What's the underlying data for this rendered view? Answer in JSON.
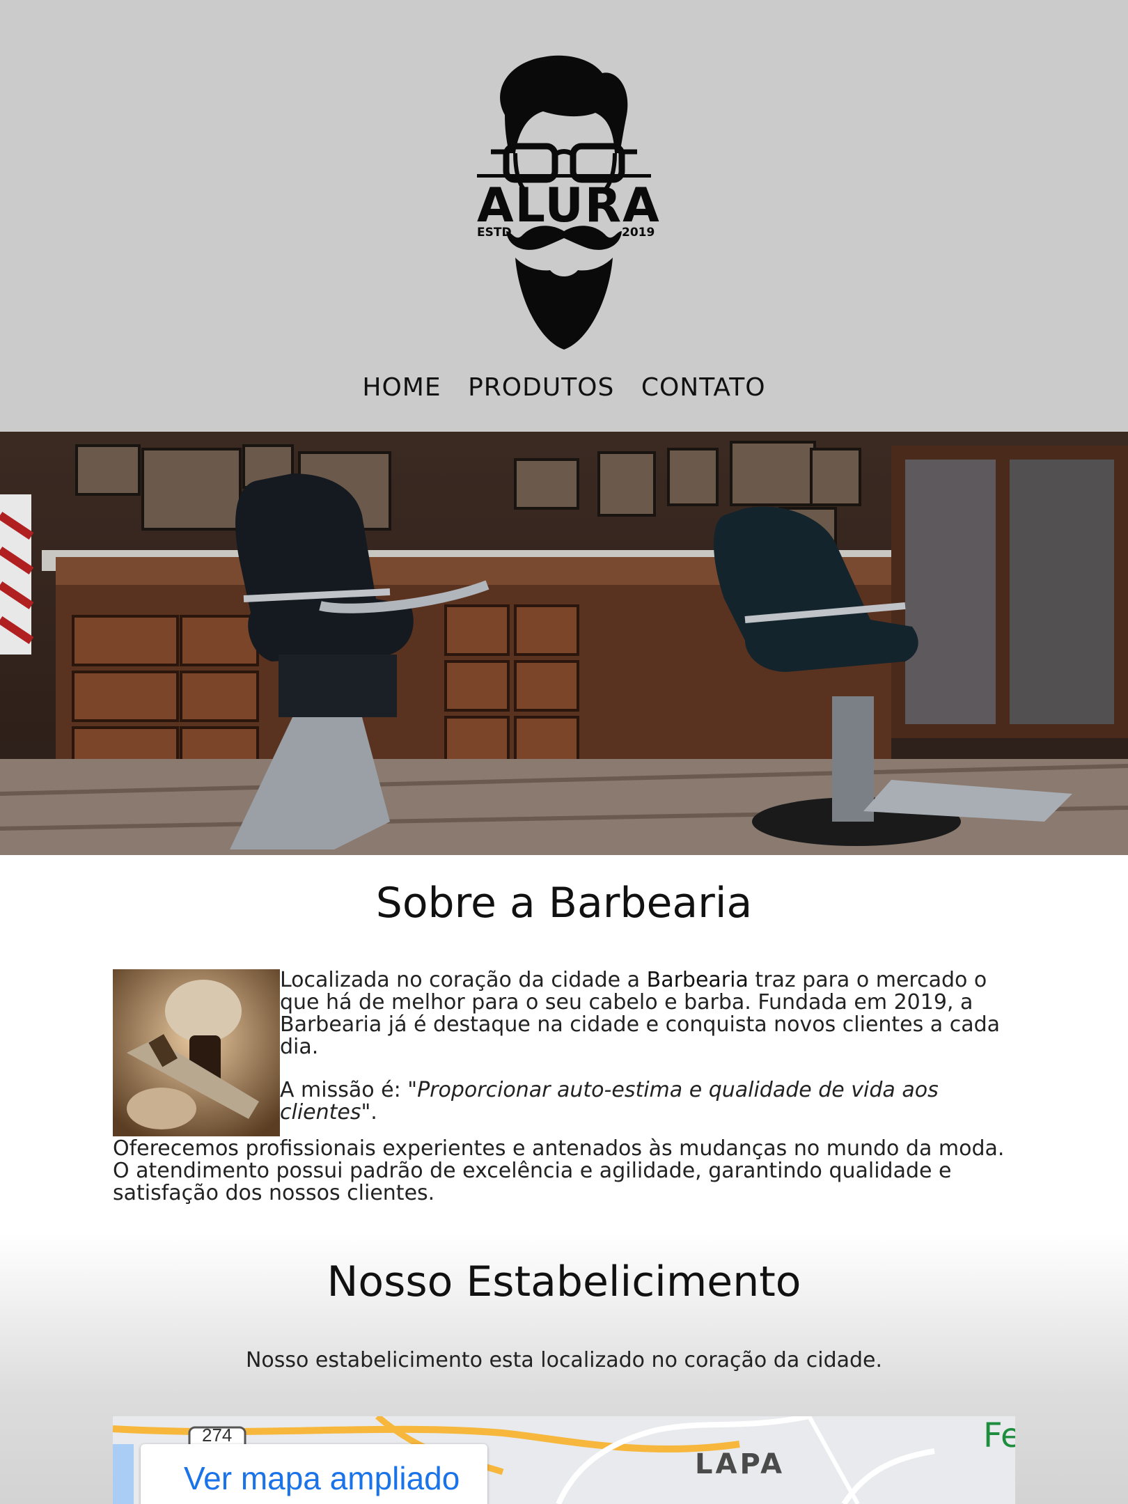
{
  "header": {
    "logo": {
      "brand": "ALURA",
      "estd": "ESTD",
      "year": "2019"
    },
    "nav": [
      "HOME",
      "PRODUTOS",
      "CONTATO"
    ],
    "background_color": "#cbcbcb"
  },
  "hero": {
    "subject": "barbershop interior with two barber chairs"
  },
  "about": {
    "title": "Sobre a Barbearia",
    "p1_before": "Localizada no coração da cidade a ",
    "p1_bold": "Barbearia",
    "p1_after": " traz para o mercado o que há de melhor para o seu cabelo e barba. Fundada em 2019, a Barbearia já é destaque na cidade e conquista novos clientes a cada dia.",
    "mission_prefix": "A missão é: ",
    "mission_quote": "\"Proporcionar auto-estima e qualidade de vida aos clientes\"",
    "mission_suffix": ".",
    "p3": "Oferecemos profissionais experientes e antenados às mudanças no mundo da moda. O atendimento possui padrão de excelência e agilidade, garantindo qualidade e satisfação dos nossos clientes."
  },
  "establishment": {
    "title": "Nosso Estabelicimento",
    "text": "Nosso estabelicimento esta localizado no coração da cidade."
  },
  "map": {
    "button_label": "Ver mapa ampliado",
    "district_label": "LAPA",
    "road_shield": "274",
    "edge_label": "Fe",
    "link_color": "#1a73e8"
  }
}
